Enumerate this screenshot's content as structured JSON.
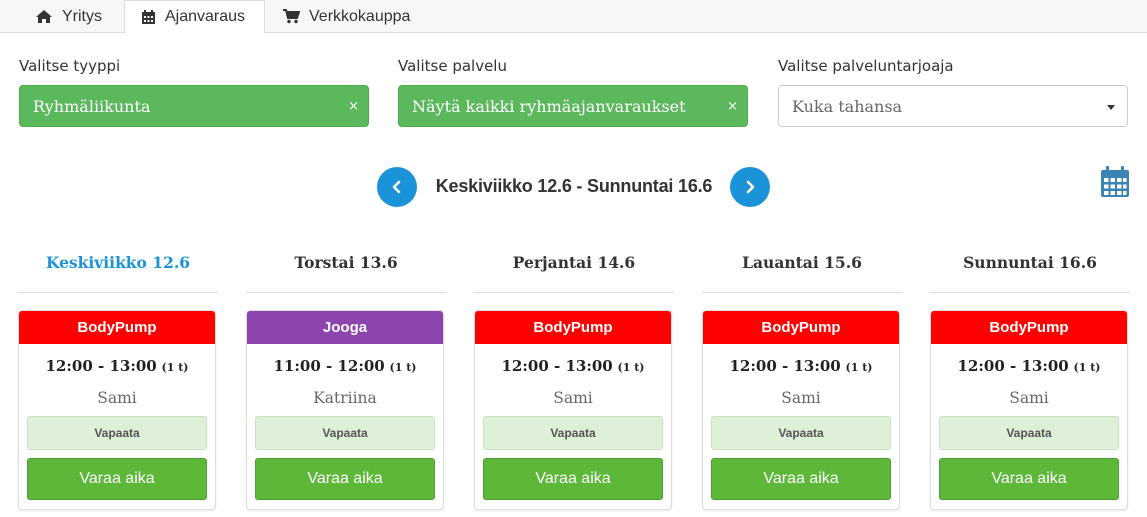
{
  "tabs": [
    {
      "label": "Yritys",
      "icon": "home-icon",
      "active": false
    },
    {
      "label": "Ajanvaraus",
      "icon": "calendar-icon",
      "active": true
    },
    {
      "label": "Verkkokauppa",
      "icon": "cart-icon",
      "active": false
    }
  ],
  "filters": {
    "type": {
      "label": "Valitse tyyppi",
      "value": "Ryhmäliikunta",
      "clear": "×"
    },
    "service": {
      "label": "Valitse palvelu",
      "value": "Näytä kaikki ryhmäajanvaraukset",
      "clear": "×"
    },
    "provider": {
      "label": "Valitse palveluntarjoaja",
      "placeholder": "Kuka tahansa"
    }
  },
  "week": {
    "title": "Keskiviikko 12.6 - Sunnuntai 16.6"
  },
  "colors": {
    "accent": "#1a93d9",
    "green": "#5cb85c",
    "bodypump": "#ff0000",
    "jooga": "#8e44ad",
    "free_bg": "#dff0d8",
    "book_btn": "#5db83a"
  },
  "days": [
    {
      "name": "Keskiviikko 12.6",
      "today": true,
      "slot": {
        "title": "BodyPump",
        "color": "#ff0000",
        "time": "12:00 - 13:00",
        "duration": "(1 t)",
        "instructor": "Sami",
        "status": "Vapaata",
        "button": "Varaa aika"
      }
    },
    {
      "name": "Torstai 13.6",
      "today": false,
      "slot": {
        "title": "Jooga",
        "color": "#8e44ad",
        "time": "11:00 - 12:00",
        "duration": "(1 t)",
        "instructor": "Katriina",
        "status": "Vapaata",
        "button": "Varaa aika"
      }
    },
    {
      "name": "Perjantai 14.6",
      "today": false,
      "slot": {
        "title": "BodyPump",
        "color": "#ff0000",
        "time": "12:00 - 13:00",
        "duration": "(1 t)",
        "instructor": "Sami",
        "status": "Vapaata",
        "button": "Varaa aika"
      }
    },
    {
      "name": "Lauantai 15.6",
      "today": false,
      "slot": {
        "title": "BodyPump",
        "color": "#ff0000",
        "time": "12:00 - 13:00",
        "duration": "(1 t)",
        "instructor": "Sami",
        "status": "Vapaata",
        "button": "Varaa aika"
      }
    },
    {
      "name": "Sunnuntai 16.6",
      "today": false,
      "slot": {
        "title": "BodyPump",
        "color": "#ff0000",
        "time": "12:00 - 13:00",
        "duration": "(1 t)",
        "instructor": "Sami",
        "status": "Vapaata",
        "button": "Varaa aika"
      }
    }
  ]
}
